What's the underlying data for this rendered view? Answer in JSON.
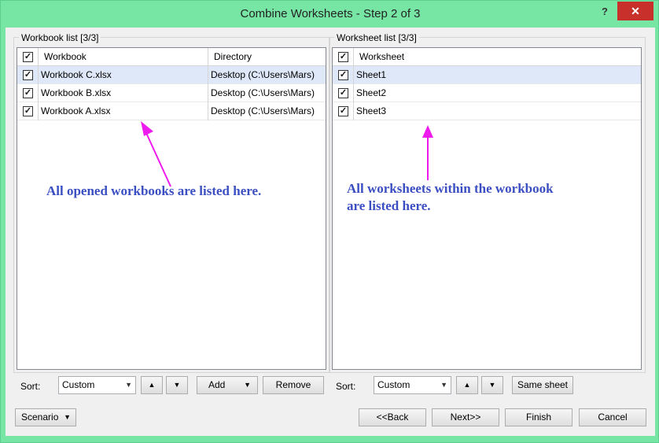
{
  "window": {
    "title": "Combine Worksheets - Step 2 of 3",
    "help_label": "?",
    "close_label": "✕"
  },
  "workbook_panel": {
    "group_label": "Workbook list [3/3]",
    "columns": [
      "Workbook",
      "Directory"
    ],
    "rows": [
      {
        "name": "Workbook C.xlsx",
        "directory": "Desktop (C:\\Users\\Mars)",
        "checked": true
      },
      {
        "name": "Workbook B.xlsx",
        "directory": "Desktop (C:\\Users\\Mars)",
        "checked": true
      },
      {
        "name": "Workbook A.xlsx",
        "directory": "Desktop (C:\\Users\\Mars)",
        "checked": true
      }
    ],
    "annotation": "All opened workbooks are listed here.",
    "sort_label": "Sort:",
    "sort_value": "Custom",
    "add_label": "Add",
    "remove_label": "Remove"
  },
  "worksheet_panel": {
    "group_label": "Worksheet list [3/3]",
    "columns": [
      "Worksheet"
    ],
    "rows": [
      {
        "name": "Sheet1",
        "checked": true
      },
      {
        "name": "Sheet2",
        "checked": true
      },
      {
        "name": "Sheet3",
        "checked": true
      }
    ],
    "annotation_line1": "All worksheets within the workbook",
    "annotation_line2": "are listed here.",
    "sort_label": "Sort:",
    "sort_value": "Custom",
    "same_sheet_label": "Same sheet"
  },
  "footer": {
    "scenario_label": "Scenario",
    "back_label": "<<Back",
    "next_label": "Next>>",
    "finish_label": "Finish",
    "cancel_label": "Cancel"
  },
  "colors": {
    "title_bar": "#77e6a5",
    "close_button": "#c7302b",
    "selected_row": "#dfe8f8",
    "annotation_text": "#3b4fc2",
    "annotation_arrow": "#ee1aee"
  }
}
